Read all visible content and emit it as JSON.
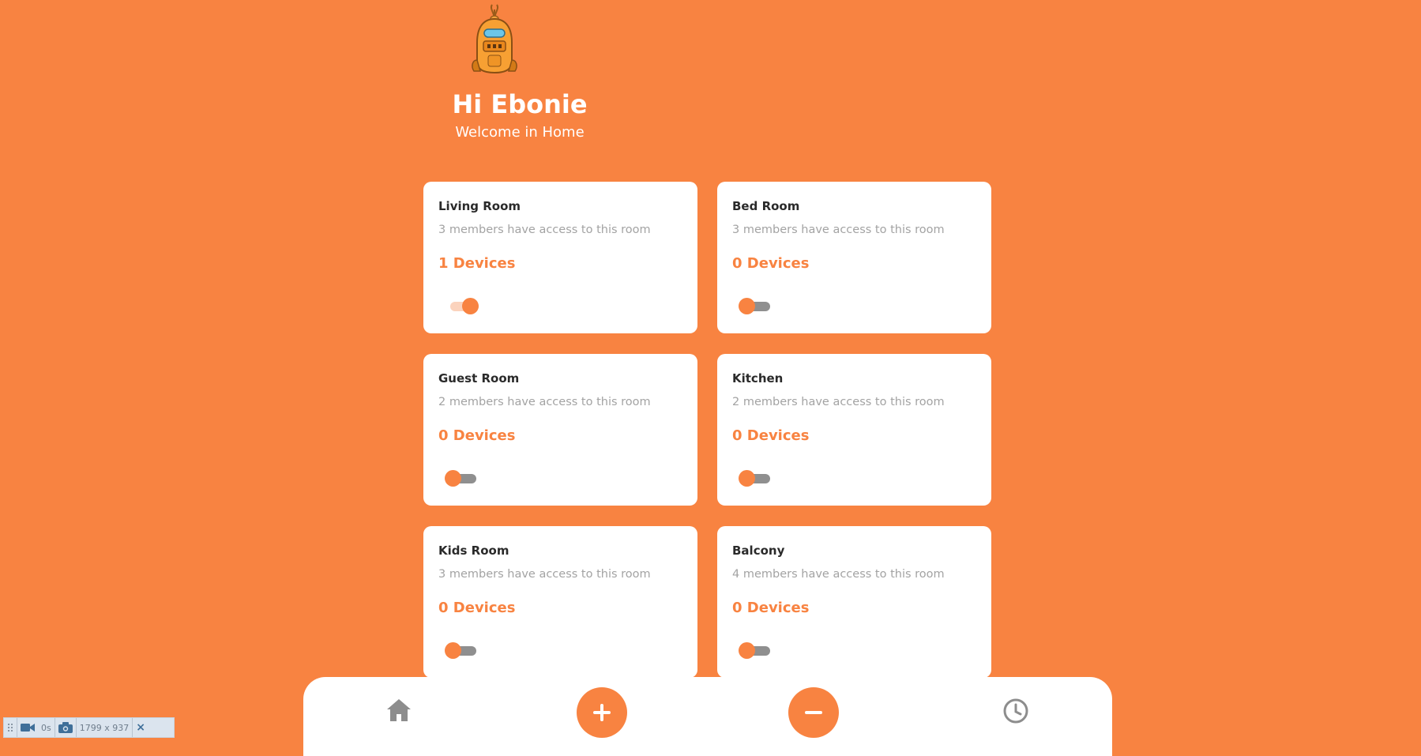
{
  "header": {
    "greeting": "Hi Ebonie",
    "welcome": "Welcome in Home"
  },
  "rooms": [
    {
      "name": "Living Room",
      "access": "3 members have access to this room",
      "devices": "1 Devices",
      "on": true
    },
    {
      "name": "Bed Room",
      "access": "3 members have access to this room",
      "devices": "0 Devices",
      "on": false
    },
    {
      "name": "Guest Room",
      "access": "2 members have access to this room",
      "devices": "0 Devices",
      "on": false
    },
    {
      "name": "Kitchen",
      "access": "2 members have access to this room",
      "devices": "0 Devices",
      "on": false
    },
    {
      "name": "Kids Room",
      "access": "3 members have access to this room",
      "devices": "0 Devices",
      "on": false
    },
    {
      "name": "Balcony",
      "access": "4 members have access to this room",
      "devices": "0 Devices",
      "on": false
    }
  ],
  "bottom_nav": {
    "icons": [
      "home-icon",
      "plus-icon",
      "minus-icon",
      "clock-icon"
    ]
  },
  "recorder_toolbar": {
    "timer": "0s",
    "size": "1799 x 937",
    "close": "×"
  },
  "colors": {
    "accent": "#f88341",
    "card": "#ffffff",
    "muted_text": "#a3a3a3",
    "toggle_off_track": "#8f8f8f"
  }
}
